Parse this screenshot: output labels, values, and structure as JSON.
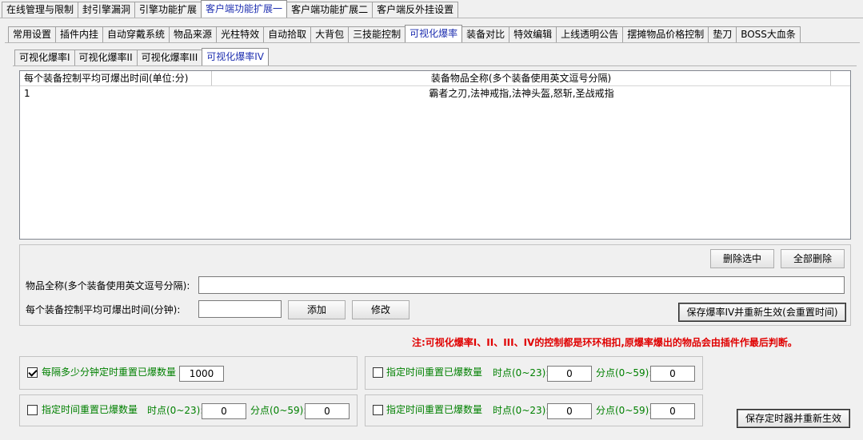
{
  "tabs_top": [
    "在线管理与限制",
    "封引擎漏洞",
    "引擎功能扩展",
    "客户端功能扩展一",
    "客户端功能扩展二",
    "客户端反外挂设置"
  ],
  "tabs_top_active": 3,
  "tabs_mid": [
    "常用设置",
    "插件内挂",
    "自动穿戴系统",
    "物品来源",
    "光柱特效",
    "自动拾取",
    "大背包",
    "三技能控制",
    "可视化爆率",
    "装备对比",
    "特效编辑",
    "上线透明公告",
    "摆摊物品价格控制",
    "垫刀",
    "BOSS大血条"
  ],
  "tabs_mid_active": 8,
  "tabs_sub": [
    "可视化爆率I",
    "可视化爆率II",
    "可视化爆率III",
    "可视化爆率IV"
  ],
  "tabs_sub_active": 3,
  "list": {
    "headers": [
      "每个装备控制平均可爆出时间(单位:分)",
      "装备物品全称(多个装备使用英文逗号分隔)"
    ],
    "rows": [
      {
        "time": "1",
        "items": "霸者之刃,法神戒指,法神头盔,怒斩,圣战戒指"
      }
    ]
  },
  "form": {
    "btn_delete_selected": "删除选中",
    "btn_delete_all": "全部删除",
    "label_items": "物品全称(多个装备使用英文逗号分隔):",
    "items_value": "",
    "label_time": "每个装备控制平均可爆出时间(分钟):",
    "time_value": "",
    "btn_add": "添加",
    "btn_modify": "修改",
    "btn_save_iv": "保存爆率IV并重新生效(会重置时间)"
  },
  "note": "注:可视化爆率I、II、III、IV的控制都是环环相扣,原爆率爆出的物品会由插件作最后判断。",
  "timers": {
    "interval": {
      "label": "每隔多少分钟定时重置已爆数量",
      "checked": true,
      "value": "1000"
    },
    "fixed1": {
      "label": "指定时间重置已爆数量",
      "checked": false,
      "hour_label": "时点(0~23):",
      "hour": "0",
      "min_label": "分点(0~59):",
      "min": "0"
    },
    "fixed2": {
      "label": "指定时间重置已爆数量",
      "checked": false,
      "hour_label": "时点(0~23):",
      "hour": "0",
      "min_label": "分点(0~59):",
      "min": "0"
    },
    "fixed3": {
      "label": "指定时间重置已爆数量",
      "checked": false,
      "hour_label": "时点(0~23):",
      "hour": "0",
      "min_label": "分点(0~59):",
      "min": "0"
    },
    "btn_save_timer": "保存定时器并重新生效"
  }
}
